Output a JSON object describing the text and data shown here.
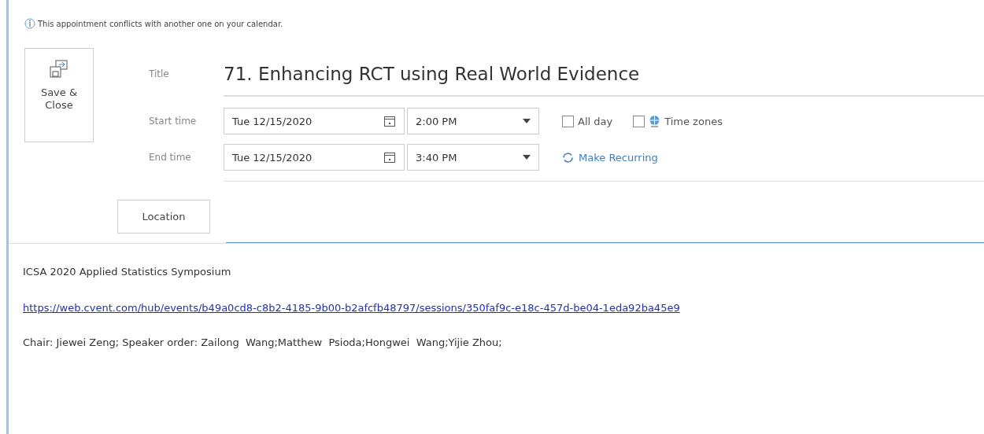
{
  "info_bar": {
    "text": "This appointment conflicts with another one on your calendar."
  },
  "save_button": {
    "label": "Save & Close"
  },
  "title": {
    "label": "Title",
    "value": "71. Enhancing RCT using Real World Evidence"
  },
  "times": [
    {
      "label": "Start time",
      "date": "Tue 12/15/2020",
      "time": "2:00 PM"
    },
    {
      "label": "End time",
      "date": "Tue 12/15/2020",
      "time": "3:40 PM"
    }
  ],
  "options": [
    {
      "kind": "checkbox",
      "label": "All day",
      "checked": false
    },
    {
      "kind": "checkbox-globe",
      "label": "Time zones",
      "checked": false
    }
  ],
  "recurring_link": "Make Recurring",
  "location": {
    "label": "Location"
  },
  "body": [
    {
      "kind": "text",
      "text": "ICSA 2020 Applied Statistics Symposium"
    },
    {
      "kind": "link",
      "text": "https://web.cvent.com/hub/events/b49a0cd8-c8b2-4185-9b00-b2afcfb48797/sessions/350faf9c-e18c-457d-be04-1eda92ba45e9"
    },
    {
      "kind": "text",
      "text": "Chair: Jiewei Zeng; Speaker order: Zailong  Wang;Matthew  Psioda;Hongwei  Wang;Yijie Zhou;"
    }
  ]
}
